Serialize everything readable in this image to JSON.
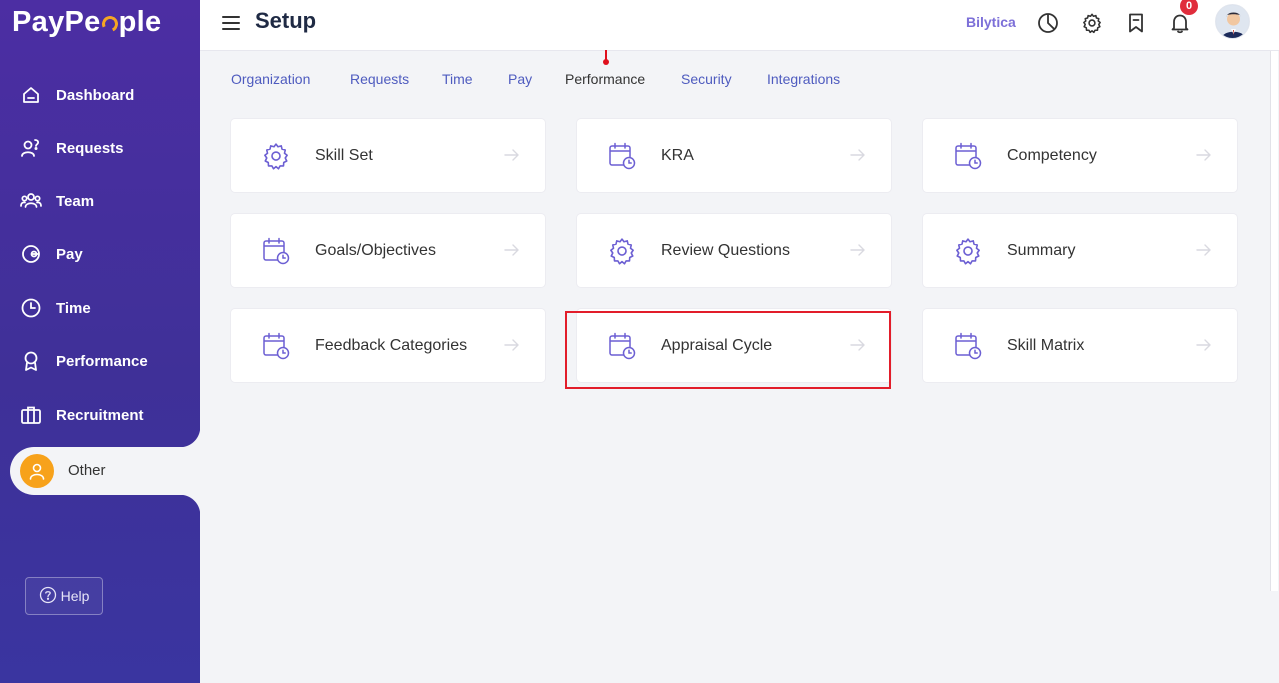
{
  "app": {
    "logo_left": "PayPe",
    "logo_right": "ple"
  },
  "sidebar": {
    "items": [
      {
        "label": "Dashboard",
        "icon": "home-icon"
      },
      {
        "label": "Requests",
        "icon": "requests-icon"
      },
      {
        "label": "Team",
        "icon": "team-icon"
      },
      {
        "label": "Pay",
        "icon": "pay-icon"
      },
      {
        "label": "Time",
        "icon": "clock-icon"
      },
      {
        "label": "Performance",
        "icon": "award-icon"
      },
      {
        "label": "Recruitment",
        "icon": "briefcase-icon"
      }
    ],
    "other_label": "Other",
    "help_label": "Help"
  },
  "header": {
    "title": "Setup",
    "company": "Bilytica",
    "notification_count": "0"
  },
  "tabs": [
    {
      "label": "Organization",
      "active": false
    },
    {
      "label": "Requests",
      "active": false
    },
    {
      "label": "Time",
      "active": false
    },
    {
      "label": "Pay",
      "active": false
    },
    {
      "label": "Performance",
      "active": true
    },
    {
      "label": "Security",
      "active": false
    },
    {
      "label": "Integrations",
      "active": false
    }
  ],
  "cards": [
    {
      "label": "Skill Set",
      "icon": "gear-icon"
    },
    {
      "label": "KRA",
      "icon": "calendar-clock-icon"
    },
    {
      "label": "Competency",
      "icon": "calendar-clock-icon"
    },
    {
      "label": "Goals/Objectives",
      "icon": "calendar-clock-icon"
    },
    {
      "label": "Review Questions",
      "icon": "gear-icon"
    },
    {
      "label": "Summary",
      "icon": "gear-icon"
    },
    {
      "label": "Feedback Categories",
      "icon": "calendar-clock-icon"
    },
    {
      "label": "Appraisal Cycle",
      "icon": "calendar-clock-icon"
    },
    {
      "label": "Skill Matrix",
      "icon": "calendar-clock-icon"
    }
  ],
  "colors": {
    "sidebar": "#4c2ea3",
    "accent": "#7c6fd8",
    "tab_link": "#4e5bbf",
    "highlight": "#e21d2a",
    "badge": "#e02d3c"
  }
}
